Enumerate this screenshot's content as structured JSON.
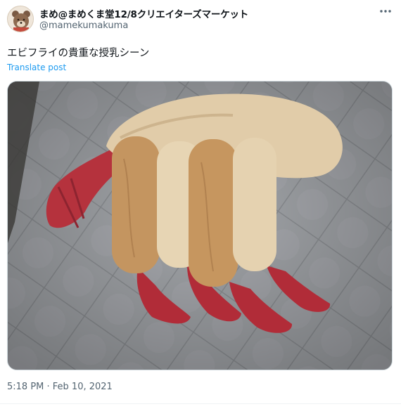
{
  "post": {
    "author_name": "まめ@まめくま堂12/8クリエイターズマーケット",
    "author_handle": "@mamekumakuma",
    "text": "エビフライの貴重な授乳シーン",
    "translate_label": "Translate post",
    "timestamp": "5:18 PM · Feb 10, 2021",
    "more_icon": "more-horizontal-icon"
  }
}
